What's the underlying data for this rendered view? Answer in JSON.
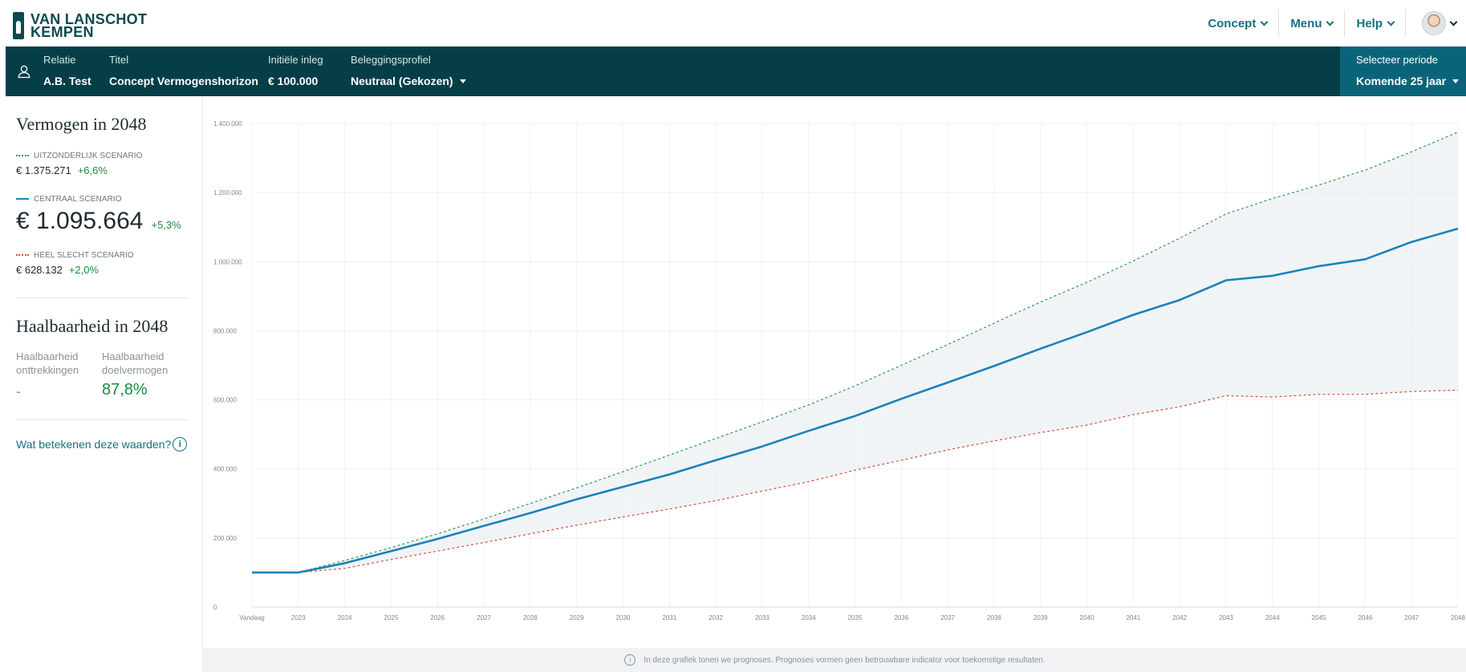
{
  "brand": {
    "line1": "VAN LANSCHOT",
    "line2": "KEMPEN"
  },
  "nav": {
    "concept": "Concept",
    "menu": "Menu",
    "help": "Help"
  },
  "context": {
    "relatie_label": "Relatie",
    "relatie_value": "A.B. Test",
    "titel_label": "Titel",
    "titel_value": "Concept Vermogenshorizon",
    "inleg_label": "Initiële inleg",
    "inleg_value": "€ 100.000",
    "profiel_label": "Beleggingsprofiel",
    "profiel_value": "Neutraal (Gekozen)",
    "periode_label": "Selecteer periode",
    "periode_value": "Komende 25 jaar"
  },
  "vermogen": {
    "title": "Vermogen in 2048",
    "scenarios": [
      {
        "label": "UITZONDERLIJK SCENARIO",
        "amount": "€ 1.375.271",
        "pct": "+6,6%"
      },
      {
        "label": "CENTRAAL SCENARIO",
        "amount": "€ 1.095.664",
        "pct": "+5,3%"
      },
      {
        "label": "HEEL SLECHT SCENARIO",
        "amount": "€ 628.132",
        "pct": "+2,0%"
      }
    ]
  },
  "haalbaarheid": {
    "title": "Haalbaarheid in 2048",
    "col1_label": "Haalbaarheid onttrekkingen",
    "col1_value": "-",
    "col2_label": "Haalbaarheid doelvermogen",
    "col2_value": "87,8%"
  },
  "help_link": "Wat betekenen deze waarden?",
  "info_glyph": "i",
  "footer_note": "In deze grafiek tonen we prognoses. Prognoses vormen geen betrouwbare indicator voor toekomstige resultaten.",
  "colors": {
    "dark_teal": "#053e47",
    "teal": "#0a6479",
    "link": "#157083",
    "central": "#1a82bb",
    "optimistic": "#2e9a59",
    "pessimistic": "#d2533f",
    "positive": "#1a8c3e"
  },
  "icons": {
    "user": "user-icon",
    "chevron": "chevron-down-icon",
    "caret": "caret-down-icon",
    "info": "info-icon"
  },
  "chart_data": {
    "type": "line",
    "x": [
      "Vandaag",
      "2023",
      "2024",
      "2025",
      "2026",
      "2027",
      "2028",
      "2029",
      "2030",
      "2031",
      "2032",
      "2033",
      "2034",
      "2035",
      "2036",
      "2037",
      "2038",
      "2039",
      "2040",
      "2041",
      "2042",
      "2043",
      "2044",
      "2045",
      "2046",
      "2047",
      "2048"
    ],
    "ylim": [
      0,
      1400000
    ],
    "yticks": [
      0,
      200000,
      400000,
      600000,
      800000,
      1000000,
      1200000,
      1400000
    ],
    "ytick_labels": [
      "0",
      "200.000",
      "400.000",
      "600.000",
      "800.000",
      "1.000.000",
      "1.200.000",
      "1.400.000"
    ],
    "grid": true,
    "band_between": [
      "Uitzonderlijk scenario",
      "Heel slecht scenario"
    ],
    "series": [
      {
        "name": "Uitzonderlijk scenario",
        "style": "dotted",
        "color": "#2e9a59",
        "values": [
          100000,
          100000,
          135000,
          172000,
          212000,
          255000,
          300000,
          345000,
          392000,
          440000,
          488000,
          536000,
          585000,
          640000,
          700000,
          760000,
          822000,
          883000,
          940000,
          1002000,
          1068000,
          1138000,
          1183000,
          1222000,
          1265000,
          1318000,
          1375271
        ]
      },
      {
        "name": "Centraal scenario",
        "style": "solid",
        "color": "#1a82bb",
        "values": [
          100000,
          100000,
          127000,
          162000,
          197000,
          235000,
          272000,
          312000,
          348000,
          384000,
          425000,
          465000,
          510000,
          553000,
          603000,
          650000,
          698000,
          748000,
          796000,
          846000,
          889000,
          946000,
          959000,
          987000,
          1007000,
          1057000,
          1095664
        ]
      },
      {
        "name": "Heel slecht scenario",
        "style": "dotted",
        "color": "#d2533f",
        "values": [
          100000,
          100000,
          112000,
          138000,
          162000,
          187000,
          212000,
          237000,
          261000,
          284000,
          308000,
          336000,
          363000,
          396000,
          425000,
          455000,
          481000,
          505000,
          527000,
          557000,
          580000,
          612000,
          608000,
          616000,
          616000,
          624000,
          628132
        ]
      }
    ]
  }
}
